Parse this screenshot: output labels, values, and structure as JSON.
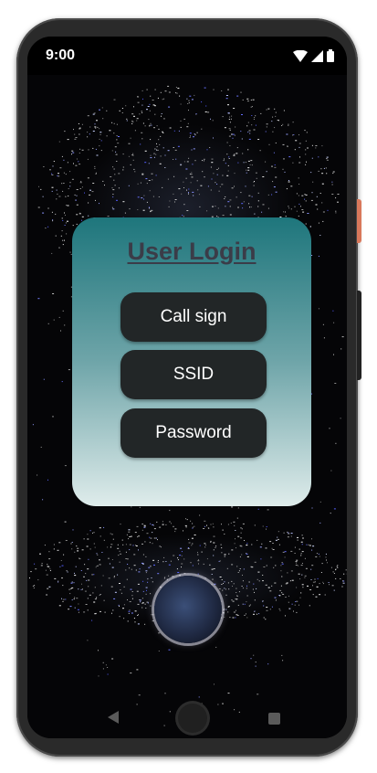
{
  "status_bar": {
    "time": "9:00"
  },
  "login": {
    "title": "User Login",
    "call_sign_label": "Call sign",
    "ssid_label": "SSID",
    "password_label": "Password"
  },
  "colors": {
    "card_top": "#1e767c",
    "card_bottom": "#dfeceb",
    "button_bg": "#222627",
    "title_color": "#3b3c48"
  },
  "icons": {
    "status": [
      "wifi-icon",
      "cell-signal-icon",
      "battery-icon"
    ],
    "nav": [
      "back-icon",
      "home-icon",
      "recents-icon"
    ]
  }
}
